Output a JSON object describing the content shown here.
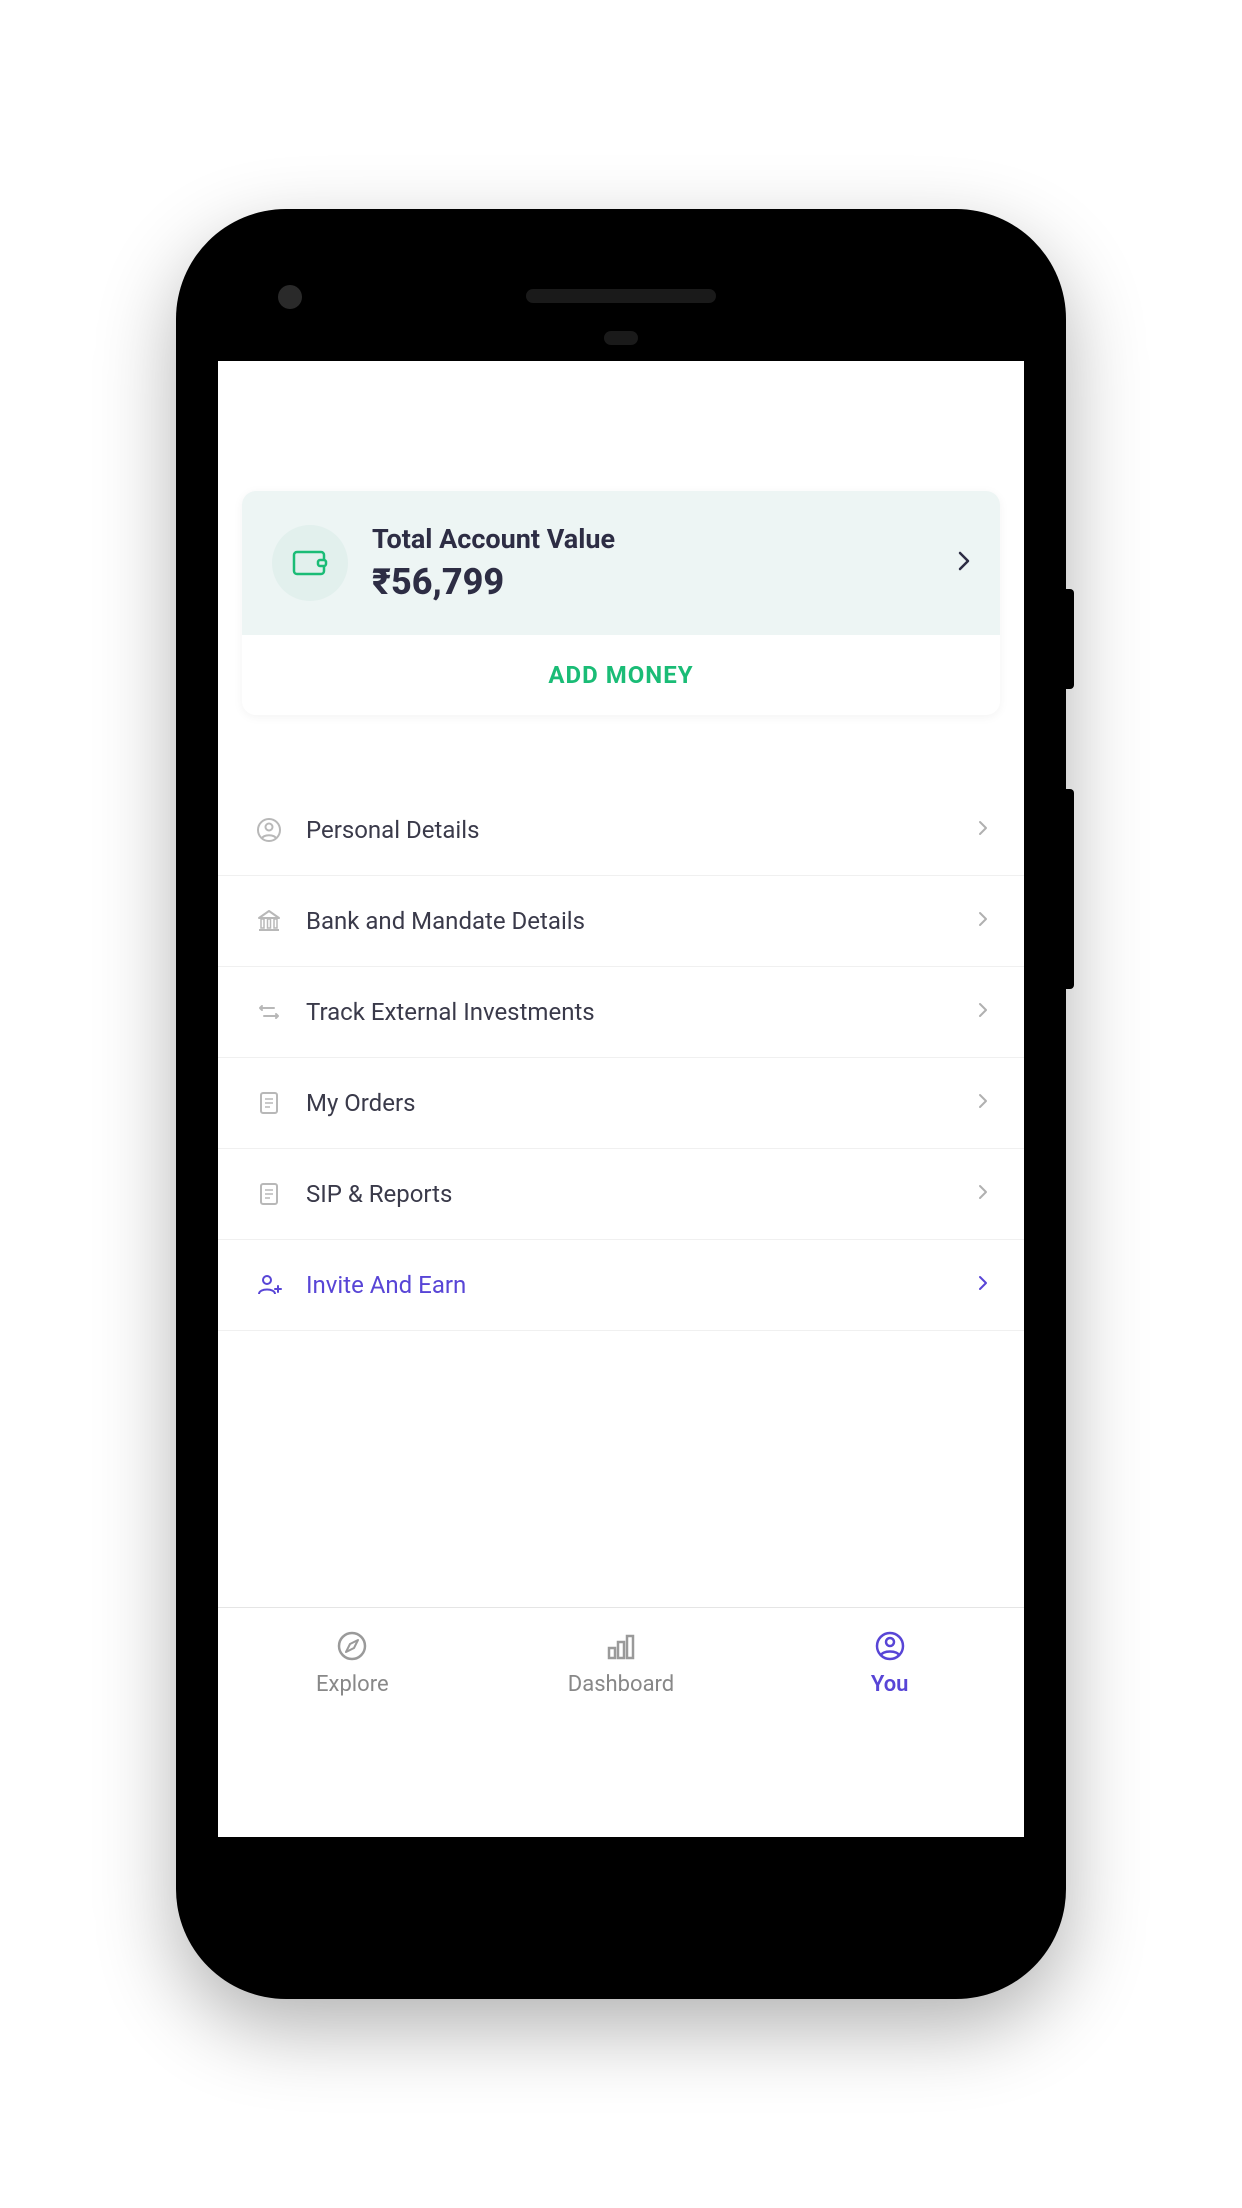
{
  "card": {
    "label": "Total Account Value",
    "value": "₹56,799",
    "button": "ADD MONEY"
  },
  "menu": [
    {
      "label": "Personal Details",
      "icon": "person-icon",
      "highlight": false
    },
    {
      "label": "Bank and Mandate Details",
      "icon": "bank-icon",
      "highlight": false
    },
    {
      "label": "Track External Investments",
      "icon": "arrows-icon",
      "highlight": false
    },
    {
      "label": "My Orders",
      "icon": "document-icon",
      "highlight": false
    },
    {
      "label": "SIP & Reports",
      "icon": "document-icon",
      "highlight": false
    },
    {
      "label": "Invite And Earn",
      "icon": "person-add-icon",
      "highlight": true
    }
  ],
  "nav": [
    {
      "label": "Explore",
      "icon": "compass-icon",
      "active": false
    },
    {
      "label": "Dashboard",
      "icon": "bars-icon",
      "active": false
    },
    {
      "label": "You",
      "icon": "person-circle-icon",
      "active": true
    }
  ],
  "colors": {
    "accent": "#5845d6",
    "green": "#1abc76",
    "gray": "#9a9a9a"
  }
}
